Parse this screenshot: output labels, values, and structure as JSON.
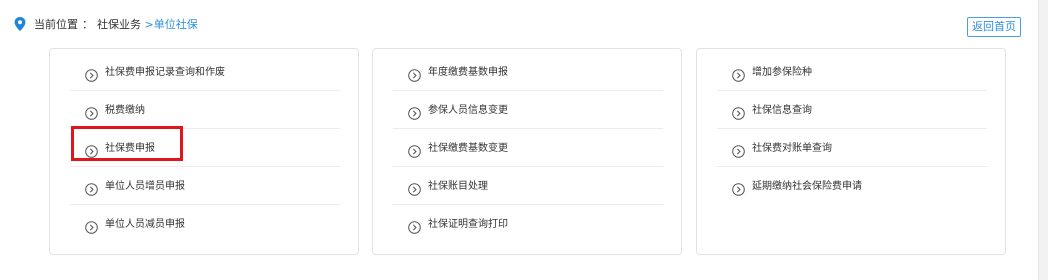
{
  "breadcrumb": {
    "prefix": "当前位置",
    "separator": "：",
    "parent": "社保业务",
    "arrow": ">",
    "current": "单位社保"
  },
  "header": {
    "back_label": "返回首页"
  },
  "columns": [
    {
      "items": [
        {
          "label": "社保费申报记录查询和作废"
        },
        {
          "label": "税费缴纳"
        },
        {
          "label": "社保费申报"
        },
        {
          "label": "单位人员增员申报"
        },
        {
          "label": "单位人员减员申报"
        }
      ]
    },
    {
      "items": [
        {
          "label": "年度缴费基数申报"
        },
        {
          "label": "参保人员信息变更"
        },
        {
          "label": "社保缴费基数变更"
        },
        {
          "label": "社保账目处理"
        },
        {
          "label": "社保证明查询打印"
        }
      ]
    },
    {
      "items": [
        {
          "label": "增加参保险种"
        },
        {
          "label": "社保信息查询"
        },
        {
          "label": "社保费对账单查询"
        },
        {
          "label": "延期缴纳社会保险费申请"
        }
      ]
    }
  ],
  "highlighted_item": "社保费申报",
  "colors": {
    "accent": "#2f8fd8",
    "highlight": "#e0161c",
    "text": "#333333"
  },
  "icons": {
    "location": "location-pin-icon",
    "item": "circle-chevron-right-icon"
  }
}
